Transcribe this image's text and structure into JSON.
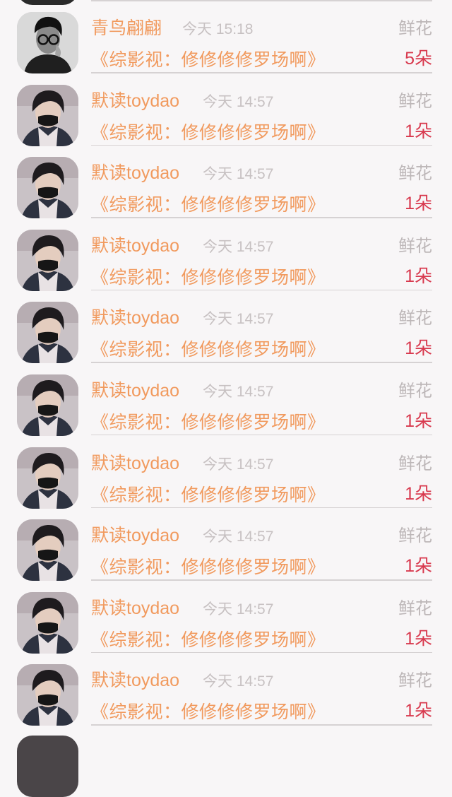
{
  "rows": [
    {
      "name": "青鸟翩翩",
      "time": "今天 15:18",
      "gift_label": "鲜花",
      "book": "《综影视：修修修修罗场啊》",
      "count": "5朵",
      "avatar": "black-white"
    },
    {
      "name": "默读toydao",
      "time": "今天 14:57",
      "gift_label": "鲜花",
      "book": "《综影视：修修修修罗场啊》",
      "count": "1朵",
      "avatar": "masked"
    },
    {
      "name": "默读toydao",
      "time": "今天 14:57",
      "gift_label": "鲜花",
      "book": "《综影视：修修修修罗场啊》",
      "count": "1朵",
      "avatar": "masked"
    },
    {
      "name": "默读toydao",
      "time": "今天 14:57",
      "gift_label": "鲜花",
      "book": "《综影视：修修修修罗场啊》",
      "count": "1朵",
      "avatar": "masked"
    },
    {
      "name": "默读toydao",
      "time": "今天 14:57",
      "gift_label": "鲜花",
      "book": "《综影视：修修修修罗场啊》",
      "count": "1朵",
      "avatar": "masked"
    },
    {
      "name": "默读toydao",
      "time": "今天 14:57",
      "gift_label": "鲜花",
      "book": "《综影视：修修修修罗场啊》",
      "count": "1朵",
      "avatar": "masked"
    },
    {
      "name": "默读toydao",
      "time": "今天 14:57",
      "gift_label": "鲜花",
      "book": "《综影视：修修修修罗场啊》",
      "count": "1朵",
      "avatar": "masked"
    },
    {
      "name": "默读toydao",
      "time": "今天 14:57",
      "gift_label": "鲜花",
      "book": "《综影视：修修修修罗场啊》",
      "count": "1朵",
      "avatar": "masked"
    },
    {
      "name": "默读toydao",
      "time": "今天 14:57",
      "gift_label": "鲜花",
      "book": "《综影视：修修修修罗场啊》",
      "count": "1朵",
      "avatar": "masked"
    },
    {
      "name": "默读toydao",
      "time": "今天 14:57",
      "gift_label": "鲜花",
      "book": "《综影视：修修修修罗场啊》",
      "count": "1朵",
      "avatar": "masked"
    }
  ],
  "colors": {
    "name": "#f19a5e",
    "book": "#f19a5e",
    "count": "#d8394e",
    "muted": "#c7c1c2",
    "background": "#f8f6f7"
  }
}
